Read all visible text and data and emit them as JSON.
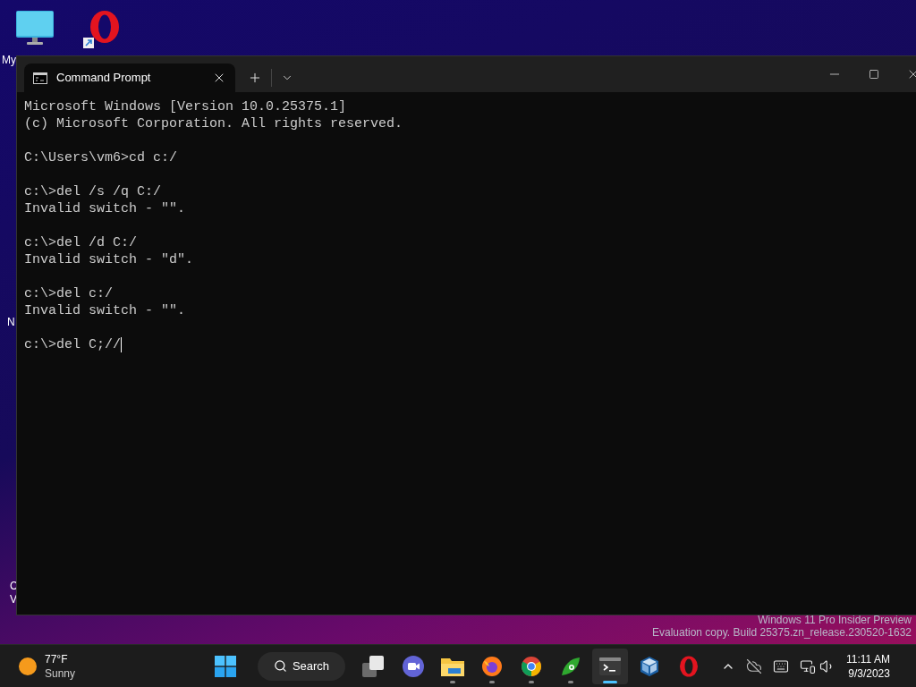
{
  "desktop": {
    "label_fragments": [
      "My",
      "N",
      "C",
      "V"
    ]
  },
  "window": {
    "tab": {
      "title": "Command Prompt",
      "selected": true
    },
    "terminal": {
      "blocks": [
        [
          "Microsoft Windows [Version 10.0.25375.1]",
          "(c) Microsoft Corporation. All rights reserved."
        ],
        [
          "C:\\Users\\vm6>cd c:/"
        ],
        [
          "c:\\>del /s /q C:/",
          "Invalid switch - \"\"."
        ],
        [
          "c:\\>del /d C:/",
          "Invalid switch - \"d\"."
        ],
        [
          "c:\\>del c:/",
          "Invalid switch - \"\"."
        ],
        [
          "c:\\>del C;//"
        ]
      ],
      "cursor": true
    }
  },
  "watermark": [
    "Windows 11 Pro Insider Preview",
    "Evaluation copy. Build 25375.zn_release.230520-1632"
  ],
  "taskbar": {
    "weather": {
      "temperature": "77°F",
      "condition": "Sunny"
    },
    "search": {
      "label": "Search"
    },
    "apps": [
      {
        "kind": "taskview",
        "running": false,
        "selected": false
      },
      {
        "kind": "meet",
        "running": false,
        "selected": false
      },
      {
        "kind": "explorer",
        "running": true,
        "selected": false
      },
      {
        "kind": "firefox",
        "running": true,
        "selected": false
      },
      {
        "kind": "chrome",
        "running": true,
        "selected": false
      },
      {
        "kind": "green",
        "running": true,
        "selected": false
      },
      {
        "kind": "terminal",
        "running": true,
        "selected": true
      },
      {
        "kind": "cube",
        "running": false,
        "selected": false
      },
      {
        "kind": "opera",
        "running": false,
        "selected": false
      }
    ],
    "clock": {
      "time": "11:11 AM",
      "date": "9/3/2023"
    }
  }
}
